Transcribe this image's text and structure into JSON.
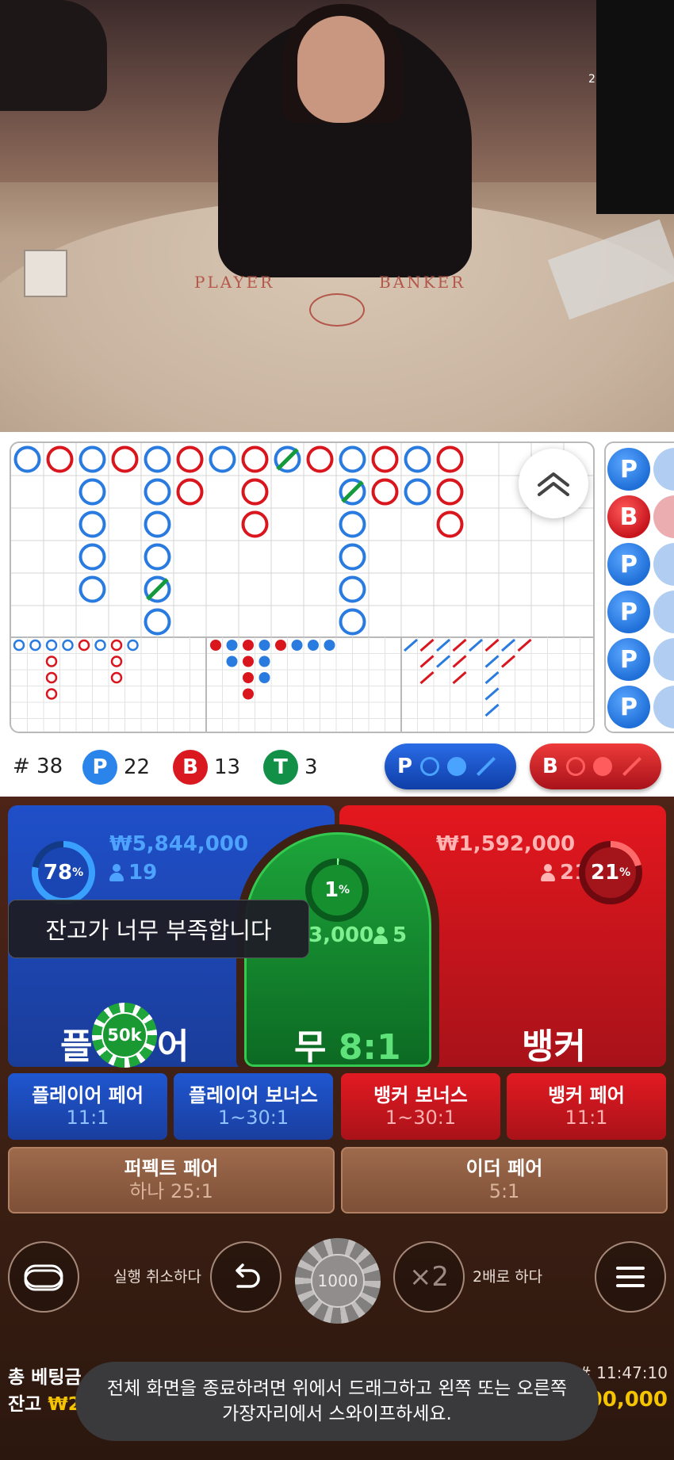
{
  "video": {
    "felt_player": "PLAYER",
    "felt_banker": "BANKER",
    "corner_number": "2"
  },
  "scoreboard": {
    "round_label": "# 38",
    "player_count": "22",
    "banker_count": "13",
    "tie_count": "3",
    "player_letter": "P",
    "banker_letter": "B",
    "tie_letter": "T",
    "side_road": [
      "P",
      "B",
      "P",
      "P",
      "P",
      "P"
    ]
  },
  "predict": {
    "player_letter": "P",
    "banker_letter": "B"
  },
  "bets": {
    "player": {
      "percent": "78",
      "percent_sign": "%",
      "amount": "₩5,844,000",
      "users": "19",
      "label_left": "플",
      "label_right": "어"
    },
    "banker": {
      "percent": "21",
      "percent_sign": "%",
      "amount": "₩1,592,000",
      "users": "21",
      "label": "뱅커"
    },
    "tie": {
      "percent": "1",
      "percent_sign": "%",
      "amount": "3,000",
      "users": "5",
      "label": "무",
      "ratio": "8:1"
    }
  },
  "toast": "잔고가 너무 부족합니다",
  "chip_selected": "50k",
  "side_bets": [
    {
      "label": "플레이어 페어",
      "odds": "11:1"
    },
    {
      "label": "플레이어 보너스",
      "odds": "1~30:1"
    },
    {
      "label": "뱅커 보너스",
      "odds": "1~30:1"
    },
    {
      "label": "뱅커 페어",
      "odds": "11:1"
    }
  ],
  "pair_bets": [
    {
      "label": "퍼펙트 페어",
      "odds": "하나 25:1"
    },
    {
      "label": "이더 페어",
      "odds": "5:1"
    }
  ],
  "controls": {
    "undo_label": "실행 취소하다",
    "double_label": "2배로 하다",
    "double_symbol": "×2",
    "chip_value": "1000"
  },
  "footer": {
    "total_bet_label": "총 베팅금",
    "balance_label": "잔고",
    "balance_prefix": "₩2",
    "round_time": "# 11:47:10",
    "balance_value": "00,000"
  },
  "system_toast": {
    "line1": "전체 화면을 종료하려면 위에서 드래그하고 왼쪽 또는 오른쪽",
    "line2": "가장자리에서 스와이프하세요."
  },
  "colors": {
    "player_blue": "#2a84ea",
    "banker_red": "#d91820",
    "tie_green": "#139047",
    "chip_green": "#1ea63a"
  }
}
